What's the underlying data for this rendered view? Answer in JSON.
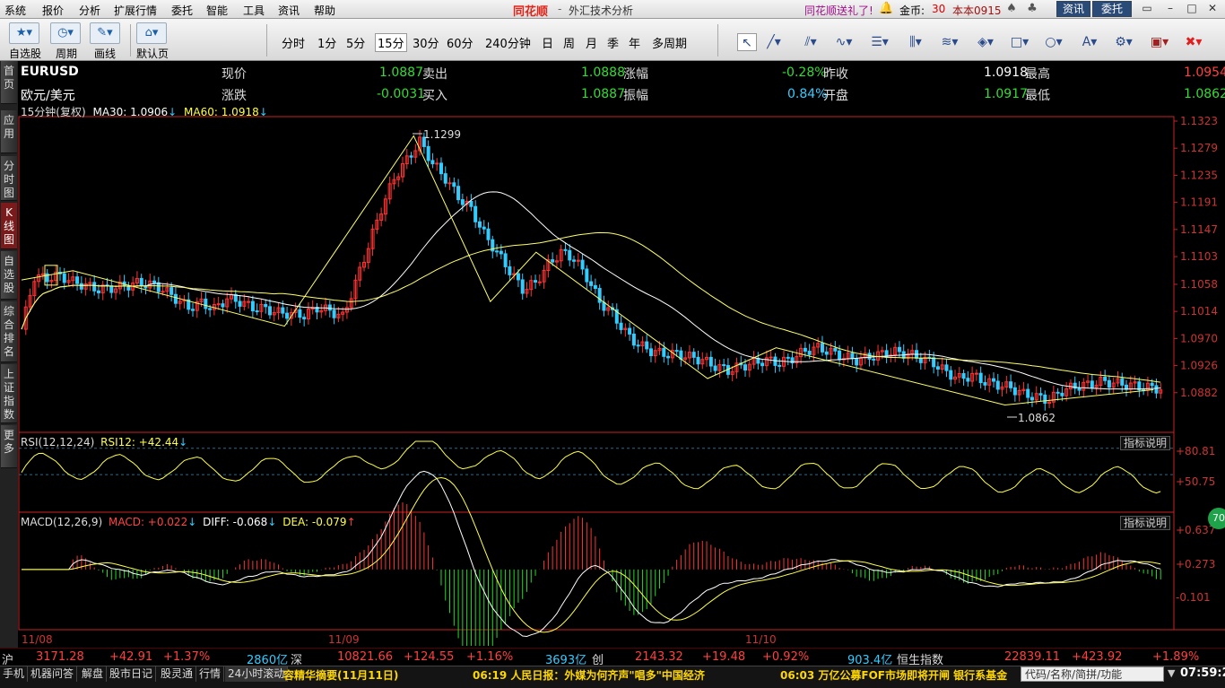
{
  "menubar": {
    "items": [
      "系统",
      "报价",
      "分析",
      "扩展行情",
      "委托",
      "智能",
      "工具",
      "资讯",
      "帮助"
    ],
    "brand": "同花顺",
    "title": "外汇技术分析",
    "promo": "同花顺送礼了!",
    "gold_label": "金币:",
    "gold_value": "30",
    "username": "本本0915",
    "btn_news": "资讯",
    "btn_trade": "委托"
  },
  "toolbar": {
    "big_buttons": [
      {
        "icon": "star-icon",
        "label": "自选股"
      },
      {
        "icon": "clock-icon",
        "label": "周期"
      },
      {
        "icon": "pencil-icon",
        "label": "画线"
      },
      {
        "icon": "home-icon",
        "label": "默认页"
      }
    ],
    "periods": [
      "分时",
      "1分",
      "5分",
      "15分",
      "30分",
      "60分",
      "240分钟",
      "日",
      "周",
      "月",
      "季",
      "年",
      "多周期"
    ],
    "active_period": "15分",
    "draw_tools": [
      "cursor-icon",
      "line-icon",
      "parallel-icon",
      "wave-icon",
      "fib-icon",
      "bars-icon",
      "channel-icon",
      "rect-icon",
      "circle-icon",
      "text-icon",
      "settings-icon",
      "save-icon",
      "delete-icon"
    ]
  },
  "left_tabs": [
    {
      "label": "首页",
      "active": false
    },
    {
      "label": "应用",
      "active": false
    },
    {
      "label": "分时图",
      "active": false
    },
    {
      "label": "K线图",
      "active": true
    },
    {
      "label": "自选股",
      "active": false
    },
    {
      "label": "综合排名",
      "active": false
    },
    {
      "label": "上证指数",
      "active": false
    },
    {
      "label": "更多",
      "active": false
    }
  ],
  "quote": {
    "symbol": "EURUSD",
    "name": "欧元/美元",
    "row1": [
      {
        "label": "现价",
        "value": "1.0887",
        "color": "green"
      },
      {
        "label": "卖出",
        "value": "1.0888",
        "color": "green"
      },
      {
        "label": "涨幅",
        "value": "-0.28%",
        "color": "green"
      },
      {
        "label": "昨收",
        "value": "1.0918",
        "color": "white"
      },
      {
        "label": "最高",
        "value": "1.0954",
        "color": "red"
      }
    ],
    "row2": [
      {
        "label": "涨跌",
        "value": "-0.0031",
        "color": "green"
      },
      {
        "label": "买入",
        "value": "1.0887",
        "color": "green"
      },
      {
        "label": "振幅",
        "value": "0.84%",
        "color": "cyan"
      },
      {
        "label": "开盘",
        "value": "1.0917",
        "color": "green"
      },
      {
        "label": "最低",
        "value": "1.0862",
        "color": "green"
      }
    ]
  },
  "main_indicator": {
    "period_label": "15分钟(复权)",
    "ma30_label": "MA30: 1.0906",
    "ma60_label": "MA60: 1.0918"
  },
  "rsi_indicator": {
    "title": "RSI(12,12,24)",
    "value_label": "RSI12: +42.44",
    "help": "指标说明",
    "ticks": [
      "+80.81",
      "+50.75"
    ]
  },
  "macd_indicator": {
    "title": "MACD(12,26,9)",
    "macd_label": "MACD: +0.022",
    "diff_label": "DIFF: -0.068",
    "dea_label": "DEA: -0.079",
    "help": "指标说明",
    "ticks": [
      "+0.637",
      "+0.273",
      "-0.101"
    ]
  },
  "date_labels": [
    "11/08",
    "11/09",
    "11/10"
  ],
  "annotations": {
    "high": "1.1299",
    "low": "1.0862"
  },
  "colors": {
    "up": "#ff3333",
    "down": "#33ccff",
    "ma_white": "#ffffff",
    "ma_yellow": "#ffff66",
    "axis": "#cc2222"
  },
  "chart_data": {
    "type": "candlestick",
    "title": "",
    "xlabel": "",
    "ylabel": "",
    "y_ticks": [
      1.1323,
      1.1279,
      1.1235,
      1.1191,
      1.1147,
      1.1103,
      1.1058,
      1.1014,
      1.097,
      1.0926,
      1.0882
    ],
    "ylim": [
      1.0838,
      1.1323
    ],
    "x_date_labels": [
      "11/08",
      "11/09",
      "11/10"
    ],
    "close_series": [
      1.0985,
      1.107,
      1.1068,
      1.1072,
      1.1062,
      1.1056,
      1.105,
      1.1052,
      1.1055,
      1.106,
      1.1058,
      1.105,
      1.1035,
      1.102,
      1.1028,
      1.1018,
      1.1035,
      1.103,
      1.102,
      1.1018,
      1.1012,
      1.101,
      1.1008,
      1.102,
      1.1015,
      1.1005,
      1.106,
      1.112,
      1.118,
      1.123,
      1.126,
      1.129,
      1.1255,
      1.123,
      1.12,
      1.118,
      1.114,
      1.111,
      1.108,
      1.105,
      1.106,
      1.109,
      1.111,
      1.11,
      1.107,
      1.103,
      1.101,
      1.098,
      1.096,
      1.095,
      1.0945,
      1.0945,
      1.094,
      1.0935,
      1.0925,
      1.0918,
      1.0925,
      1.093,
      1.0935,
      1.093,
      1.0938,
      1.095,
      1.0955,
      1.0948,
      1.094,
      1.0935,
      1.094,
      1.0945,
      1.0948,
      1.0945,
      1.0938,
      1.093,
      1.0915,
      1.0905,
      1.091,
      1.09,
      1.0895,
      1.089,
      1.088,
      1.0875,
      1.087,
      1.0885,
      1.0892,
      1.0895,
      1.09,
      1.0898,
      1.0895,
      1.0892,
      1.089,
      1.0887
    ],
    "high": 1.1299,
    "low": 1.0862,
    "rsi_ticks": [
      80.81,
      50.75
    ],
    "macd_ticks": [
      0.637,
      0.273,
      -0.101
    ]
  }
}
